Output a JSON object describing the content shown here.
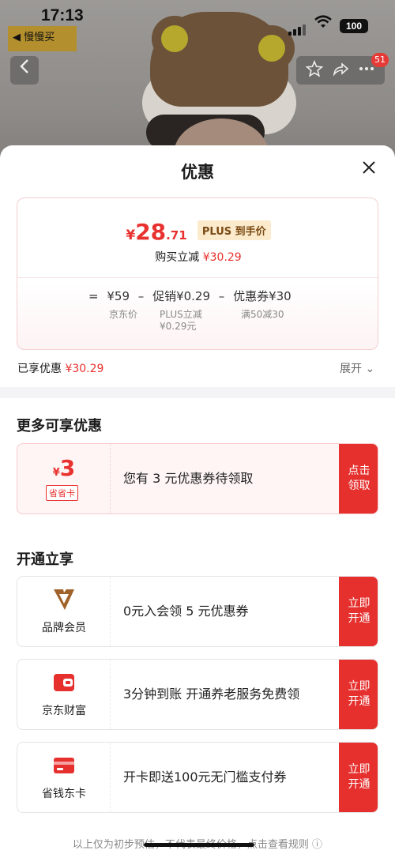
{
  "status_bar": {
    "time": "17:13",
    "back_app": "◀ 慢慢买",
    "battery": "100"
  },
  "product_nav": {
    "back_icon": "chevron-left-icon",
    "badge_count": "51"
  },
  "sheet": {
    "title": "优惠",
    "price": {
      "currency": "¥",
      "integer": "28",
      "decimal": ".71",
      "plus_tag": "PLUS 到手价",
      "reduce_label": "购买立减 ",
      "reduce_amount": "¥30.29"
    },
    "formula": {
      "eq": "=",
      "base": "¥59",
      "minus1": "–",
      "promo": "促销¥0.29",
      "minus2": "–",
      "coupon": "优惠券¥30",
      "base_sub": "京东价",
      "promo_sub1": "PLUS立减",
      "promo_sub2": "¥0.29元",
      "coupon_sub": "满50减30"
    },
    "enjoyed": {
      "label": "已享优惠 ",
      "amount": "¥30.29",
      "expand": "展开 ⌄"
    },
    "more_title": "更多可享优惠",
    "coupon_offer": {
      "currency": "¥",
      "value": "3",
      "tag": "省省卡",
      "text": "您有 3 元优惠券待领取",
      "button": "点击领取"
    },
    "open_title": "开通立享",
    "open_offers": [
      {
        "label": "品牌会员",
        "text": "0元入会领 5 元优惠券",
        "button": "立即开通",
        "icon": "brand-v-icon"
      },
      {
        "label": "京东财富",
        "text": "3分钟到账 开通养老服务免费领",
        "button": "立即开通",
        "icon": "wallet-icon"
      },
      {
        "label": "省钱东卡",
        "text": "开卡即送100元无门槛支付券",
        "button": "立即开通",
        "icon": "card-icon"
      }
    ],
    "footer": "以上仅为初步预估，不代表最终价格，点击查看规则 ⓘ"
  },
  "colors": {
    "accent": "#e5302e",
    "plus_tag_bg": "#fbeacb"
  }
}
